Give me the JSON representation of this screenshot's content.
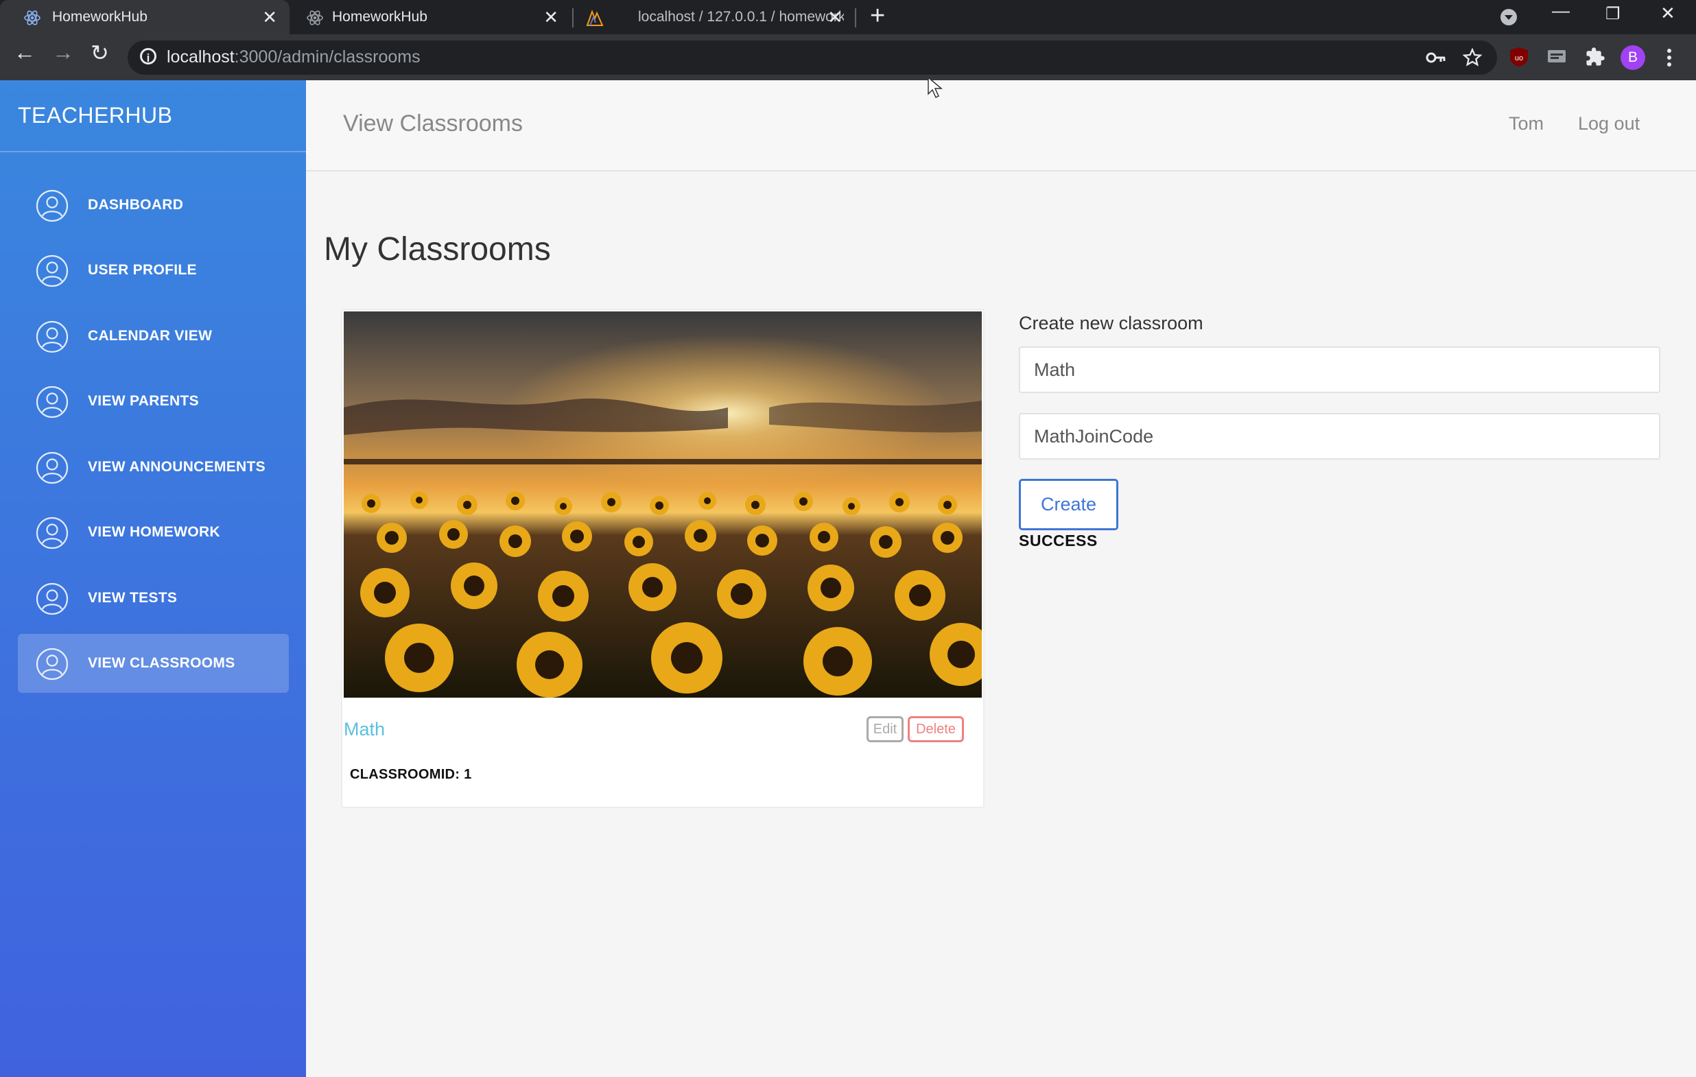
{
  "browser": {
    "tabs": [
      {
        "title": "HomeworkHub",
        "active": true,
        "icon": "react-icon"
      },
      {
        "title": "HomeworkHub",
        "active": false,
        "icon": "react-icon"
      },
      {
        "title": "localhost / 127.0.0.1 / homework",
        "active": false,
        "icon": "phpmyadmin-icon"
      }
    ],
    "close_glyph": "✕",
    "new_tab_glyph": "+",
    "url_host": "localhost",
    "url_rest": ":3000/admin/classrooms",
    "profile_initial": "B",
    "window_controls": {
      "minimize": "—",
      "restore": "❐",
      "close": "✕"
    },
    "nav_glyphs": {
      "back": "←",
      "forward": "→",
      "reload": "↻"
    }
  },
  "sidebar": {
    "brand": "TEACHERHUB",
    "items": [
      {
        "label": "DASHBOARD",
        "active": false
      },
      {
        "label": "USER PROFILE",
        "active": false
      },
      {
        "label": "CALENDAR VIEW",
        "active": false
      },
      {
        "label": "VIEW PARENTS",
        "active": false
      },
      {
        "label": "VIEW ANNOUNCEMENTS",
        "active": false
      },
      {
        "label": "VIEW HOMEWORK",
        "active": false
      },
      {
        "label": "VIEW TESTS",
        "active": false
      },
      {
        "label": "VIEW CLASSROOMS",
        "active": true
      }
    ]
  },
  "header": {
    "title": "View Classrooms",
    "user_name": "Tom",
    "logout_label": "Log out"
  },
  "main": {
    "title": "My Classrooms",
    "classrooms": [
      {
        "name": "Math",
        "id_label": "CLASSROOMID: 1",
        "image": "sunflower-field-sunset"
      }
    ],
    "edit_label": "Edit",
    "delete_label": "Delete"
  },
  "create_form": {
    "title": "Create new classroom",
    "name_value": "Math",
    "code_value": "MathJoinCode",
    "create_label": "Create",
    "status": "SUCCESS"
  },
  "colors": {
    "sidebar_top": "#3a87de",
    "sidebar_bottom": "#4062de",
    "accent": "#3f76d6",
    "link": "#5bc0de",
    "danger": "#f08080"
  }
}
